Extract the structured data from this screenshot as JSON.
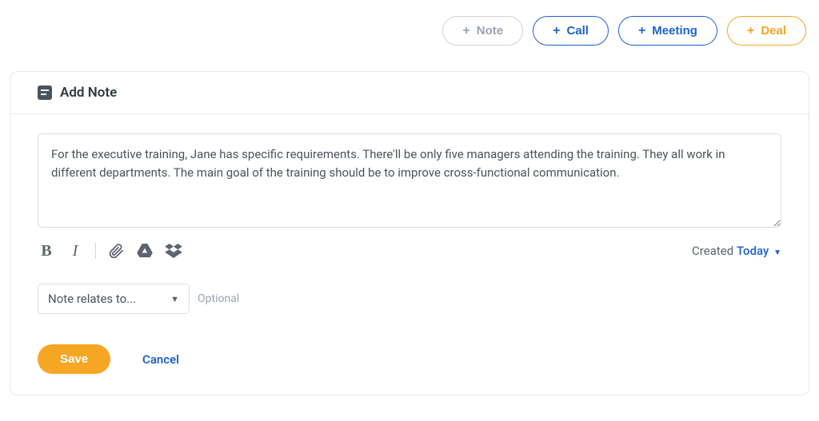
{
  "action_buttons": {
    "note": "Note",
    "call": "Call",
    "meeting": "Meeting",
    "deal": "Deal"
  },
  "panel": {
    "title": "Add Note",
    "textarea_value": "For the executive training, Jane has specific requirements. There'll be only five managers attending the training. They all work in different departments. The main goal of the training should be to improve cross-functional communication.",
    "created_label": "Created",
    "created_value": "Today",
    "relates_label": "Note relates to...",
    "optional_label": "Optional",
    "save_label": "Save",
    "cancel_label": "Cancel"
  }
}
